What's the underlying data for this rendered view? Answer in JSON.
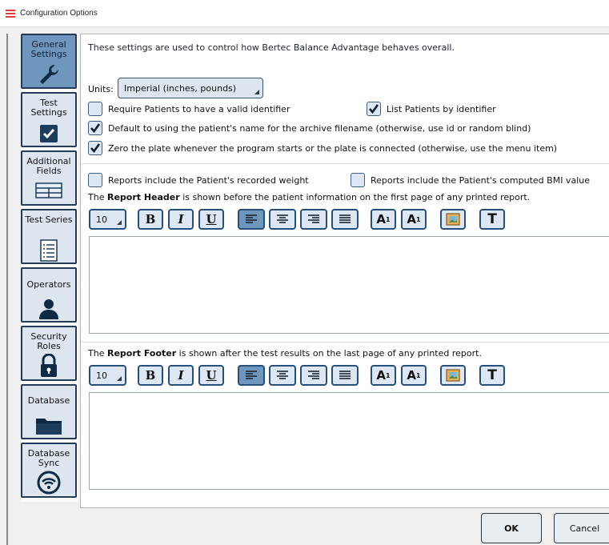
{
  "window": {
    "title": "Configuration Options"
  },
  "sidebar": {
    "items": [
      {
        "label": "General Settings",
        "icon": "wrench-icon",
        "active": true
      },
      {
        "label": "Test Settings",
        "icon": "checkbox-icon",
        "active": false
      },
      {
        "label": "Additional Fields",
        "icon": "table-icon",
        "active": false
      },
      {
        "label": "Test Series",
        "icon": "list-icon",
        "active": false
      },
      {
        "label": "Operators",
        "icon": "person-icon",
        "active": false
      },
      {
        "label": "Security Roles",
        "icon": "lock-icon",
        "active": false
      },
      {
        "label": "Database",
        "icon": "folder-icon",
        "active": false
      },
      {
        "label": "Database Sync",
        "icon": "sync-wifi-icon",
        "active": false
      }
    ]
  },
  "general": {
    "intro": "These settings are used to control how Bertec Balance Advantage behaves overall.",
    "units_label": "Units:",
    "units_value": "Imperial (inches, pounds)",
    "require_identifier": {
      "label": "Require Patients to have a valid identifier",
      "checked": false
    },
    "list_by_identifier": {
      "label": "List Patients by identifier",
      "checked": true
    },
    "default_name": {
      "label": "Default to using the patient's name for the archive filename (otherwise, use id or random blind)",
      "checked": true
    },
    "zero_plate": {
      "label": "Zero the plate whenever the program starts or the plate is connected (otherwise, use the menu item)",
      "checked": true
    },
    "recorded_weight": {
      "label": "Reports include the Patient's recorded weight",
      "checked": false
    },
    "computed_bmi": {
      "label": "Reports include the Patient's computed BMI value",
      "checked": false
    },
    "header_note": {
      "pre": "The ",
      "bold": "Report Header",
      "post": " is shown before the patient information on the first page of any printed report."
    },
    "footer_note": {
      "pre": "The ",
      "bold": "Report Footer",
      "post": " is shown after the test results on the last page of any printed report."
    }
  },
  "toolbar": {
    "font_size": "10",
    "bold": "B",
    "italic": "I",
    "underline": "U",
    "text_style": "T",
    "superscript": "A",
    "subscript": "A"
  },
  "buttons": {
    "ok": "OK",
    "cancel": "Cancel"
  },
  "colors": {
    "accent": "#6f96bc",
    "border": "#264f7a",
    "button_bg": "#dce7f3"
  }
}
